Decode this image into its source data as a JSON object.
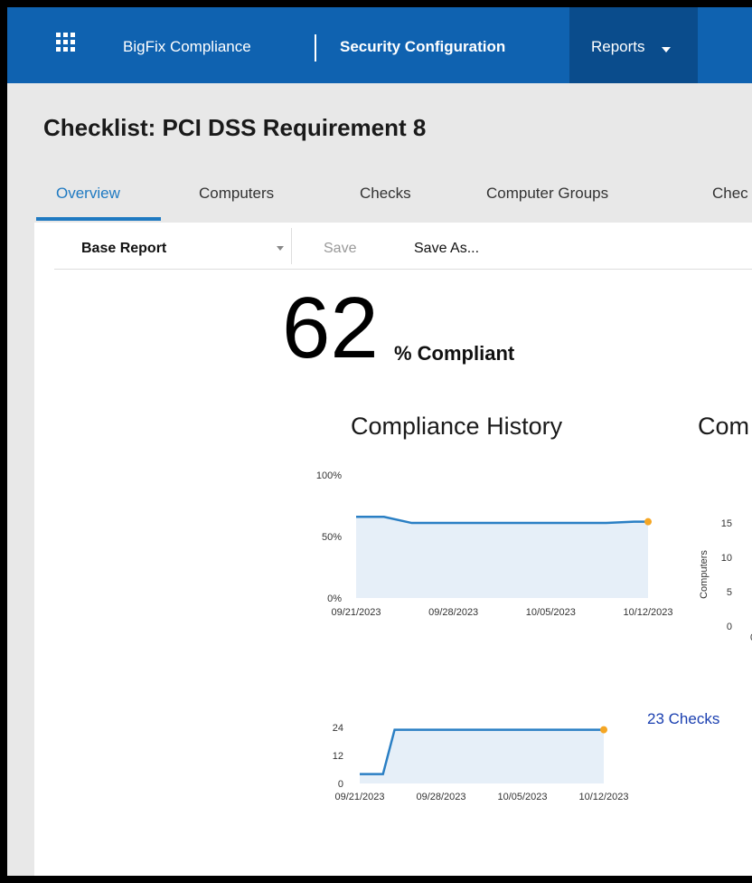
{
  "nav": {
    "app_name": "BigFix Compliance",
    "section": "Security Configuration",
    "reports": "Reports"
  },
  "page": {
    "title": "Checklist: PCI DSS Requirement 8"
  },
  "tabs": [
    {
      "label": "Overview",
      "active": true
    },
    {
      "label": "Computers",
      "active": false
    },
    {
      "label": "Checks",
      "active": false
    },
    {
      "label": "Computer Groups",
      "active": false
    },
    {
      "label": "Chec",
      "active": false
    }
  ],
  "toolbar": {
    "report_select": "Base Report",
    "save": "Save",
    "save_as": "Save As..."
  },
  "summary": {
    "compliance_value": "62",
    "compliance_label": "% Compliant"
  },
  "history_title": "Compliance History",
  "second_title": "Com",
  "checks_link": "23 Checks",
  "colors": {
    "nav_bg": "#0f62b0",
    "nav_active": "#0a4c8c",
    "accent": "#1f7ac2",
    "line": "#2a7fc4",
    "fill": "#e6eff8",
    "marker": "#f5a623",
    "link": "#1a3fb0"
  },
  "chart_data": [
    {
      "type": "area",
      "title": "Compliance History",
      "x_ticks": [
        "09/21/2023",
        "09/28/2023",
        "10/05/2023",
        "10/12/2023"
      ],
      "y_ticks": [
        "0%",
        "50%",
        "100%"
      ],
      "ylim": [
        0,
        100
      ],
      "x": [
        "09/21/2023",
        "09/23/2023",
        "09/25/2023",
        "10/09/2023",
        "10/11/2023",
        "10/12/2023"
      ],
      "values": [
        66,
        66,
        61,
        61,
        62,
        62
      ]
    },
    {
      "type": "bar",
      "title": "Com",
      "ylabel": "Computers",
      "y_ticks": [
        "0",
        "5",
        "10",
        "15"
      ],
      "partial_tick": "0"
    },
    {
      "type": "area",
      "x_ticks": [
        "09/21/2023",
        "09/28/2023",
        "10/05/2023",
        "10/12/2023"
      ],
      "y_ticks": [
        "0",
        "12",
        "24"
      ],
      "ylim": [
        0,
        24
      ],
      "x": [
        "09/21/2023",
        "09/23/2023",
        "09/24/2023",
        "10/12/2023"
      ],
      "values": [
        4,
        4,
        23,
        23
      ]
    }
  ]
}
